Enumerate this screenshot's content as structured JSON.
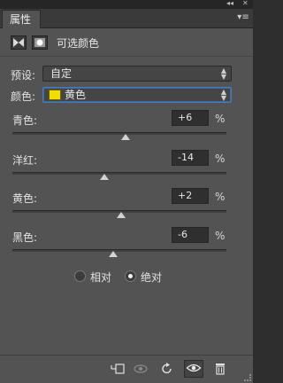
{
  "window": {
    "collapse_glyph": "◂◂",
    "close_glyph": "✕"
  },
  "tab": {
    "label": "属性",
    "menu_glyph": "▾≡"
  },
  "header": {
    "title": "可选颜色"
  },
  "preset": {
    "label": "预设:",
    "value": "自定"
  },
  "colors": {
    "label": "颜色:",
    "value": "黄色",
    "swatch_color": "#f2dd00"
  },
  "channels": [
    {
      "label": "青色:",
      "value": "+6",
      "percent": "%",
      "amount": 6
    },
    {
      "label": "洋红:",
      "value": "-14",
      "percent": "%",
      "amount": -14
    },
    {
      "label": "黄色:",
      "value": "+2",
      "percent": "%",
      "amount": 2
    },
    {
      "label": "黑色:",
      "value": "-6",
      "percent": "%",
      "amount": -6
    }
  ],
  "method": {
    "relative_label": "相对",
    "absolute_label": "绝对",
    "selected": "absolute"
  },
  "footer": {
    "clip_icon": "clip-to-layer-icon",
    "view_previous_icon": "view-previous-state-icon",
    "reset_icon": "reset-icon",
    "visibility_icon": "eye-icon",
    "delete_icon": "trash-icon"
  }
}
